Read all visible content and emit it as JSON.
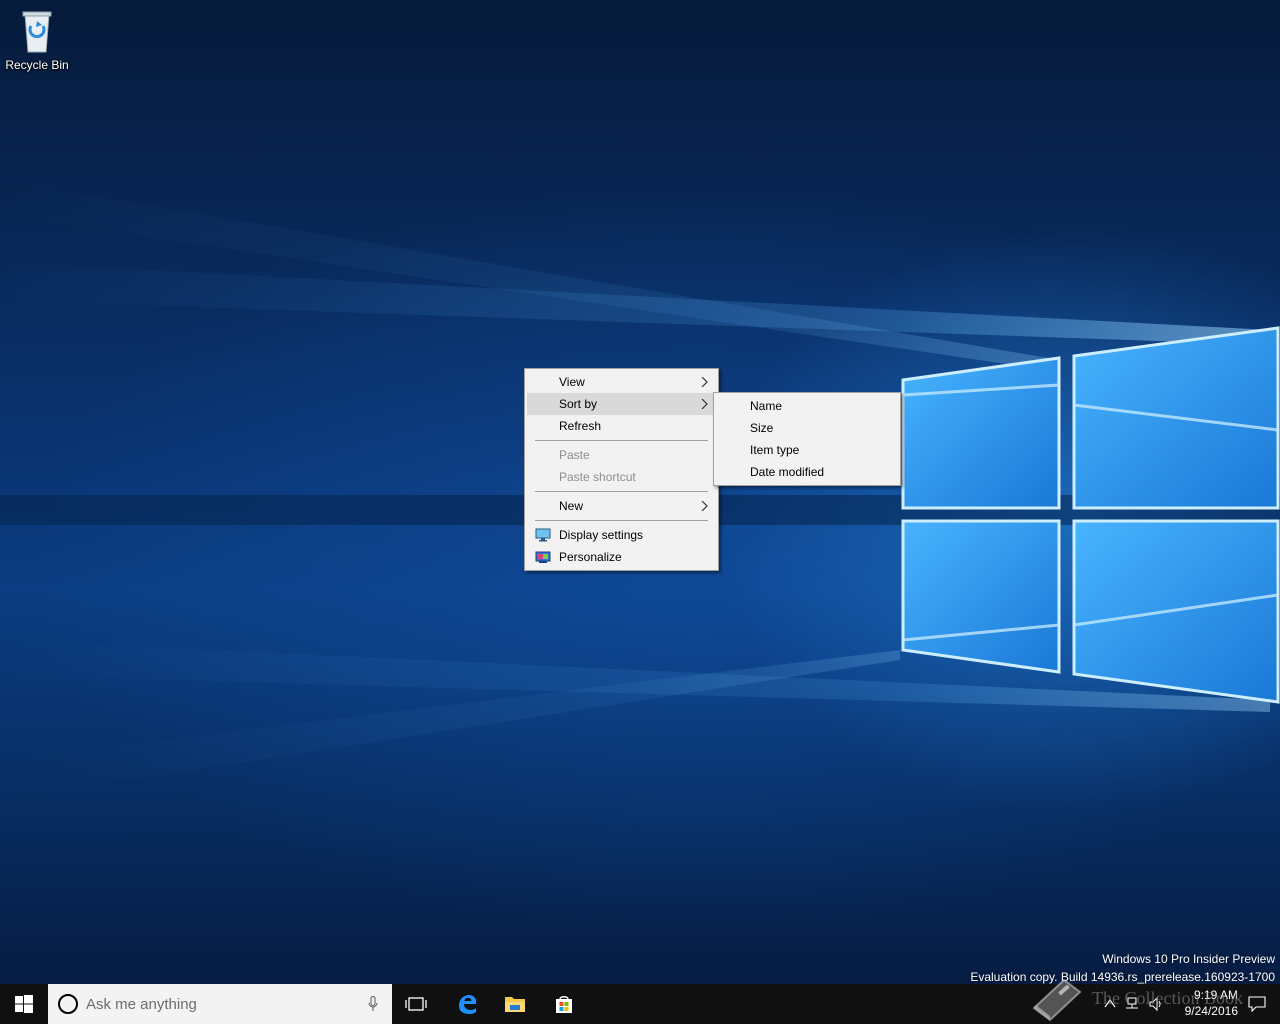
{
  "desktop": {
    "icons": [
      {
        "label": "Recycle Bin",
        "icon": "recycle-bin-icon"
      }
    ]
  },
  "context_menu": {
    "items": [
      {
        "label": "View",
        "has_submenu": true,
        "enabled": true
      },
      {
        "label": "Sort by",
        "has_submenu": true,
        "enabled": true,
        "highlighted": true
      },
      {
        "label": "Refresh",
        "has_submenu": false,
        "enabled": true
      },
      {
        "label": "Paste",
        "has_submenu": false,
        "enabled": false
      },
      {
        "label": "Paste shortcut",
        "has_submenu": false,
        "enabled": false
      },
      {
        "label": "New",
        "has_submenu": true,
        "enabled": true
      },
      {
        "label": "Display settings",
        "icon": "display-icon",
        "enabled": true
      },
      {
        "label": "Personalize",
        "icon": "personalize-icon",
        "enabled": true
      }
    ]
  },
  "sort_submenu": {
    "items": [
      {
        "label": "Name"
      },
      {
        "label": "Size"
      },
      {
        "label": "Item type"
      },
      {
        "label": "Date modified"
      }
    ]
  },
  "watermark": {
    "line1": "Windows 10 Pro Insider Preview",
    "line2": "Evaluation copy. Build 14936.rs_prerelease.160923-1700"
  },
  "taskbar": {
    "search_placeholder": "Ask me anything",
    "pinned": [
      "task-view-icon",
      "edge-icon",
      "file-explorer-icon",
      "store-icon"
    ],
    "clock_time": "9:19 AM",
    "clock_date": "9/24/2016"
  },
  "overlay_logo": {
    "text": "The Collection Book"
  },
  "colors": {
    "menu_bg": "#f2f2f2",
    "menu_highlight": "#d9d9d9",
    "disabled_text": "#8d8d8d",
    "taskbar_bg": "#101010",
    "accent": "#0078d7"
  }
}
